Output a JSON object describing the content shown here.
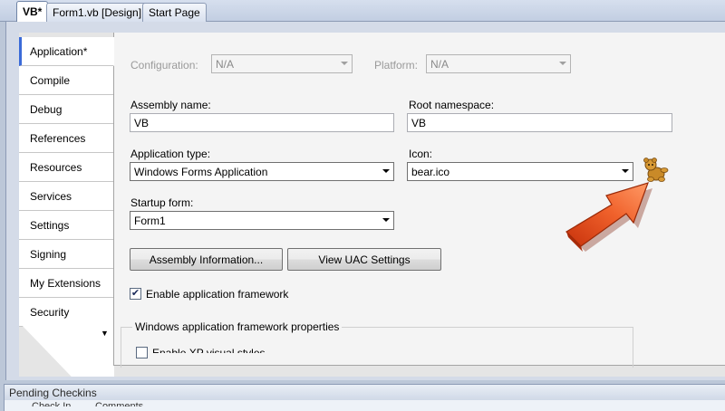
{
  "doc_tabs": [
    {
      "label": "VB*",
      "active": true
    },
    {
      "label": "Form1.vb [Design]",
      "active": false
    },
    {
      "label": "Start Page",
      "active": false
    }
  ],
  "nav": {
    "items": [
      {
        "label": "Application*",
        "active": true
      },
      {
        "label": "Compile"
      },
      {
        "label": "Debug"
      },
      {
        "label": "References"
      },
      {
        "label": "Resources"
      },
      {
        "label": "Services"
      },
      {
        "label": "Settings"
      },
      {
        "label": "Signing"
      },
      {
        "label": "My Extensions"
      },
      {
        "label": "Security"
      }
    ],
    "scroll_glyph": "▼"
  },
  "config": {
    "configuration_label": "Configuration:",
    "configuration_value": "N/A",
    "platform_label": "Platform:",
    "platform_value": "N/A"
  },
  "assembly_name": {
    "label": "Assembly name:",
    "value": "VB"
  },
  "root_namespace": {
    "label": "Root namespace:",
    "value": "VB"
  },
  "application_type": {
    "label": "Application type:",
    "value": "Windows Forms Application"
  },
  "icon": {
    "label": "Icon:",
    "value": "bear.ico",
    "preview_icon": "bear-icon"
  },
  "startup_form": {
    "label": "Startup form:",
    "value": "Form1"
  },
  "buttons": {
    "assembly_information": "Assembly Information...",
    "view_uac_settings": "View UAC Settings"
  },
  "framework": {
    "enable_label": "Enable application framework",
    "enabled": true,
    "group_title": "Windows application framework properties",
    "xp_styles_label": "Enable XP visual styles"
  },
  "pending": {
    "title": "Pending Checkins",
    "toolbar": {
      "check_in": "Check In",
      "comments": "Comments"
    }
  },
  "colors": {
    "arrow": "#e8501e",
    "active_tab_accent": "#3a6ad8"
  }
}
